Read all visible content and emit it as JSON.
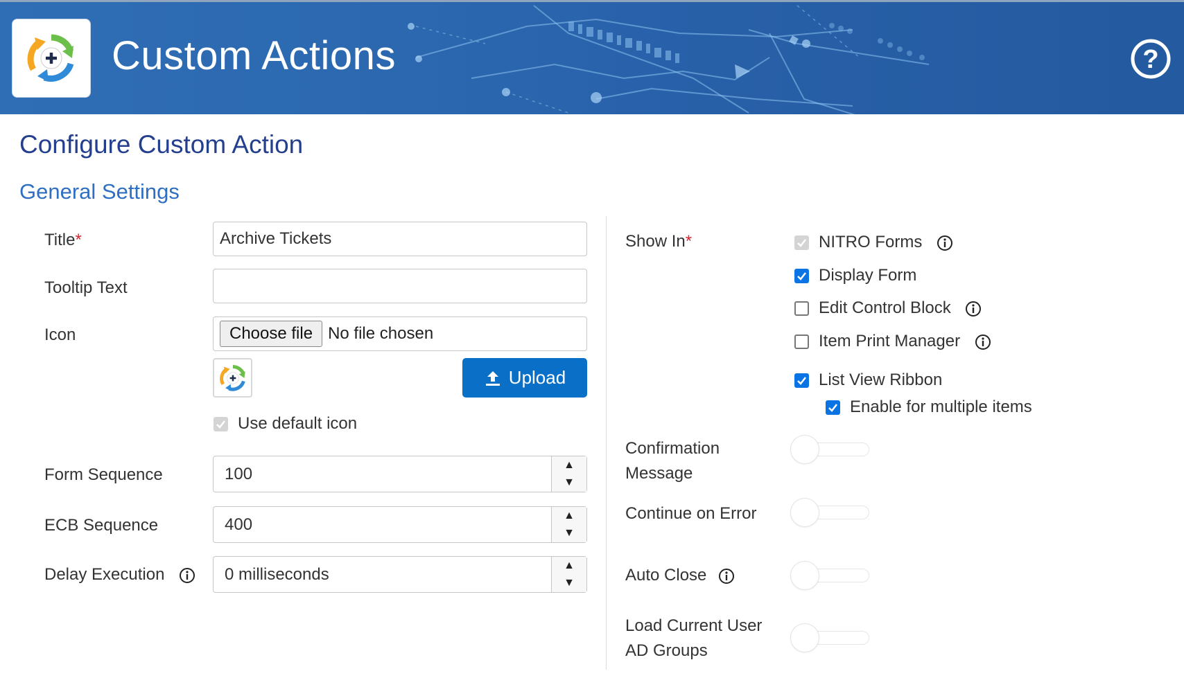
{
  "header": {
    "app_title": "Custom Actions",
    "logo_icon": "custom-actions-logo-icon",
    "help_icon": "help-circle-icon",
    "banner_color": "#2b68b0"
  },
  "page": {
    "title": "Configure Custom Action",
    "section": "General Settings"
  },
  "left": {
    "title_label": "Title",
    "title_value": "Archive Tickets",
    "tooltip_label": "Tooltip Text",
    "tooltip_value": "",
    "icon_label": "Icon",
    "choose_file": "Choose file",
    "file_status": "No file chosen",
    "upload_label": "Upload",
    "use_default_icon": "Use default icon",
    "use_default_icon_checked": true,
    "form_sequence_label": "Form Sequence",
    "form_sequence_value": "100",
    "ecb_sequence_label": "ECB Sequence",
    "ecb_sequence_value": "400",
    "delay_label": "Delay Execution",
    "delay_value": "0 milliseconds"
  },
  "right": {
    "show_in_label": "Show In",
    "options": [
      {
        "label": "NITRO Forms",
        "checked": true,
        "disabled": true,
        "info": true
      },
      {
        "label": "Display Form",
        "checked": true,
        "disabled": false,
        "info": false
      },
      {
        "label": "Edit Control Block",
        "checked": false,
        "disabled": false,
        "info": true
      },
      {
        "label": "Item Print Manager",
        "checked": false,
        "disabled": false,
        "info": true
      },
      {
        "label": "List View Ribbon",
        "checked": true,
        "disabled": false,
        "info": false
      },
      {
        "label": "Enable for multiple items",
        "checked": true,
        "disabled": false,
        "info": false
      }
    ],
    "confirmation_line1": "Confirmation",
    "confirmation_line2": "Message",
    "confirmation_on": false,
    "continue_on_error": "Continue on Error",
    "continue_on_error_on": false,
    "auto_close": "Auto Close",
    "auto_close_on": false,
    "load_groups_line1": "Load Current User",
    "load_groups_line2": "AD Groups",
    "load_groups_on": false
  },
  "colors": {
    "accent": "#0a6fc7",
    "heading": "#243f8e",
    "section": "#2f6fc2",
    "required": "#d9232e",
    "checkbox_on": "#0b74e5"
  }
}
